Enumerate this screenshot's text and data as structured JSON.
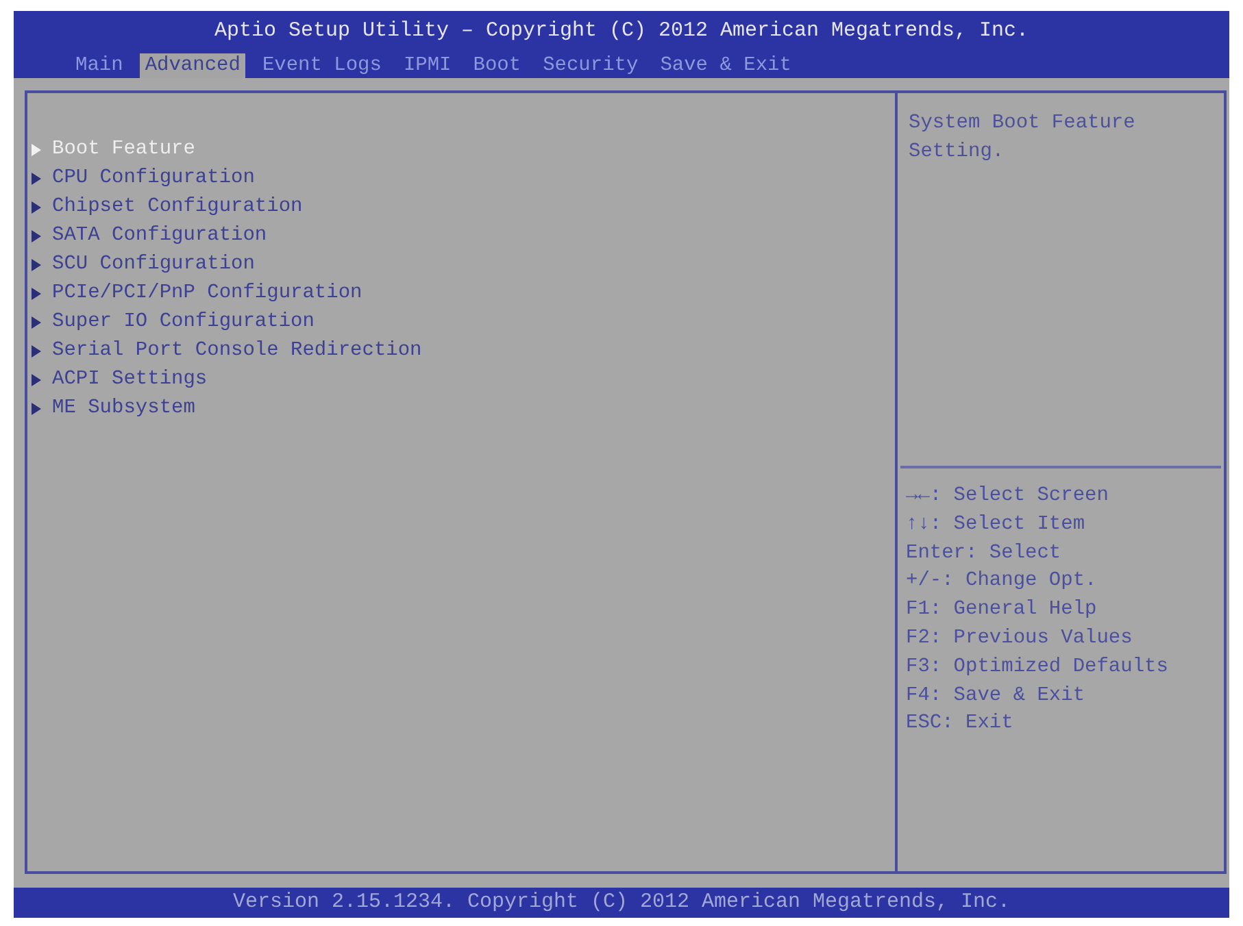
{
  "window": {
    "title": "Aptio Setup Utility – Copyright (C) 2012 American Megatrends, Inc."
  },
  "tabs": [
    {
      "label": "Main",
      "selected": false
    },
    {
      "label": "Advanced",
      "selected": true
    },
    {
      "label": "Event Logs",
      "selected": false
    },
    {
      "label": "IPMI",
      "selected": false
    },
    {
      "label": "Boot",
      "selected": false
    },
    {
      "label": "Security",
      "selected": false
    },
    {
      "label": "Save & Exit",
      "selected": false
    }
  ],
  "menu": {
    "items": [
      {
        "label": "Boot Feature",
        "selected": true
      },
      {
        "label": "CPU Configuration",
        "selected": false
      },
      {
        "label": "Chipset Configuration",
        "selected": false
      },
      {
        "label": "SATA Configuration",
        "selected": false
      },
      {
        "label": "SCU Configuration",
        "selected": false
      },
      {
        "label": "PCIe/PCI/PnP Configuration",
        "selected": false
      },
      {
        "label": "Super IO Configuration",
        "selected": false
      },
      {
        "label": "Serial Port Console Redirection",
        "selected": false
      },
      {
        "label": "ACPI Settings",
        "selected": false
      },
      {
        "label": "ME Subsystem",
        "selected": false
      }
    ]
  },
  "help": {
    "description": "System Boot Feature Setting.",
    "keys": [
      "→←: Select Screen",
      "↑↓: Select Item",
      "Enter: Select",
      "+/-: Change Opt.",
      "F1: General Help",
      "F2: Previous Values",
      "F3: Optimized Defaults",
      "F4: Save & Exit",
      "ESC: Exit"
    ]
  },
  "status_bar": {
    "text": "Version 2.15.1234. Copyright (C) 2012 American Megatrends, Inc."
  }
}
